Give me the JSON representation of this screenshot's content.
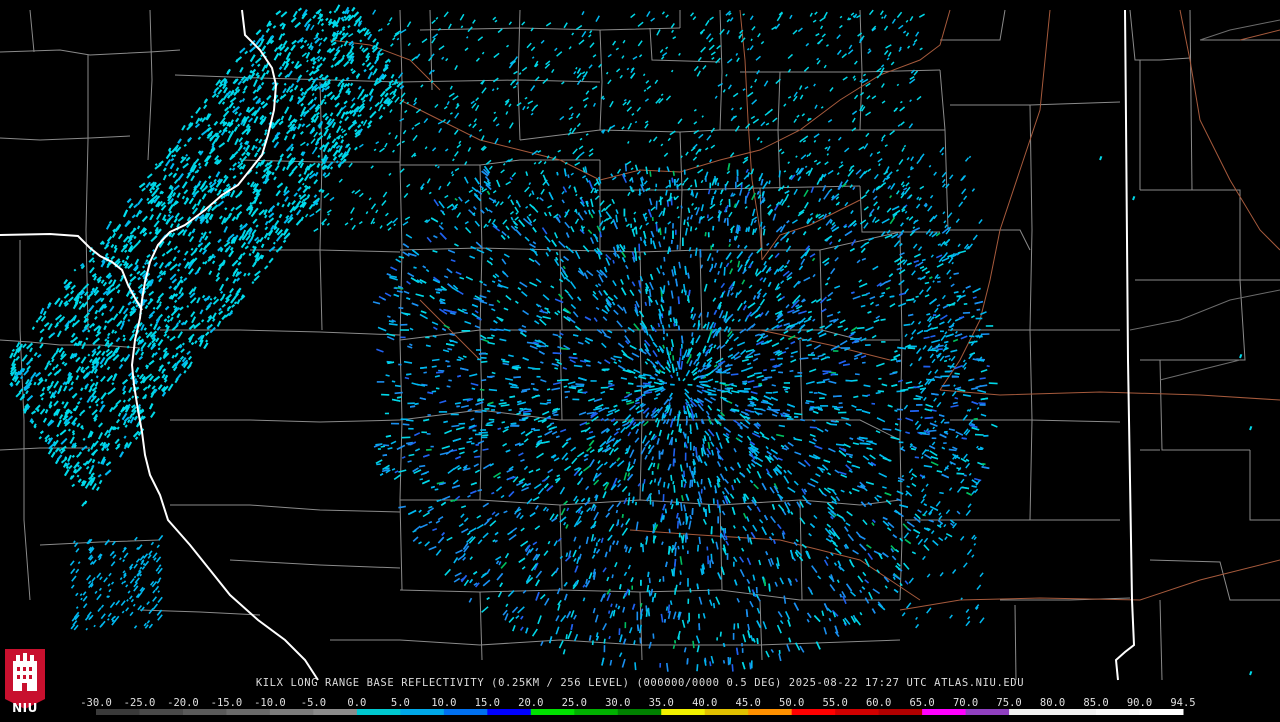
{
  "caption": {
    "text": "KILX LONG RANGE BASE REFLECTIVITY (0.25KM / 256 LEVEL) (000000/0000 0.5 DEG) 2025-08-22 17:27 UTC  ATLAS.NIU.EDU"
  },
  "logo": {
    "label": "NIU",
    "color": "#c8102e"
  },
  "legend": {
    "ticks": [
      "-30.0",
      "-25.0",
      "-20.0",
      "-15.0",
      "-10.0",
      "-5.0",
      "0.0",
      "5.0",
      "10.0",
      "15.0",
      "20.0",
      "25.0",
      "30.0",
      "35.0",
      "40.0",
      "45.0",
      "50.0",
      "55.0",
      "60.0",
      "65.0",
      "70.0",
      "75.0",
      "80.0",
      "85.0",
      "90.0",
      "94.5"
    ],
    "colors": [
      "#3a3a3a",
      "#4a4a4a",
      "#5a5a5a",
      "#6a6a6a",
      "#7c7c7c",
      "#8c8c8c",
      "#00c8d0",
      "#00a8e8",
      "#0070f0",
      "#0000ff",
      "#00e000",
      "#00b000",
      "#008000",
      "#f0f000",
      "#e0c000",
      "#ff9000",
      "#ff0000",
      "#d00000",
      "#b00000",
      "#ff00ff",
      "#9040c0",
      "#f0f0f0",
      "#f0f0f0",
      "#f8f8f8",
      "#ffffff"
    ]
  },
  "map": {
    "background": "#000000",
    "state_border_color": "#ffffff",
    "county_line_color": "#9a9a9a",
    "river_color": "#a05a3a",
    "echo_colors": [
      "#00d8e8",
      "#00b8f0",
      "#1a8ff0",
      "#2060f0",
      "#00c060"
    ]
  }
}
